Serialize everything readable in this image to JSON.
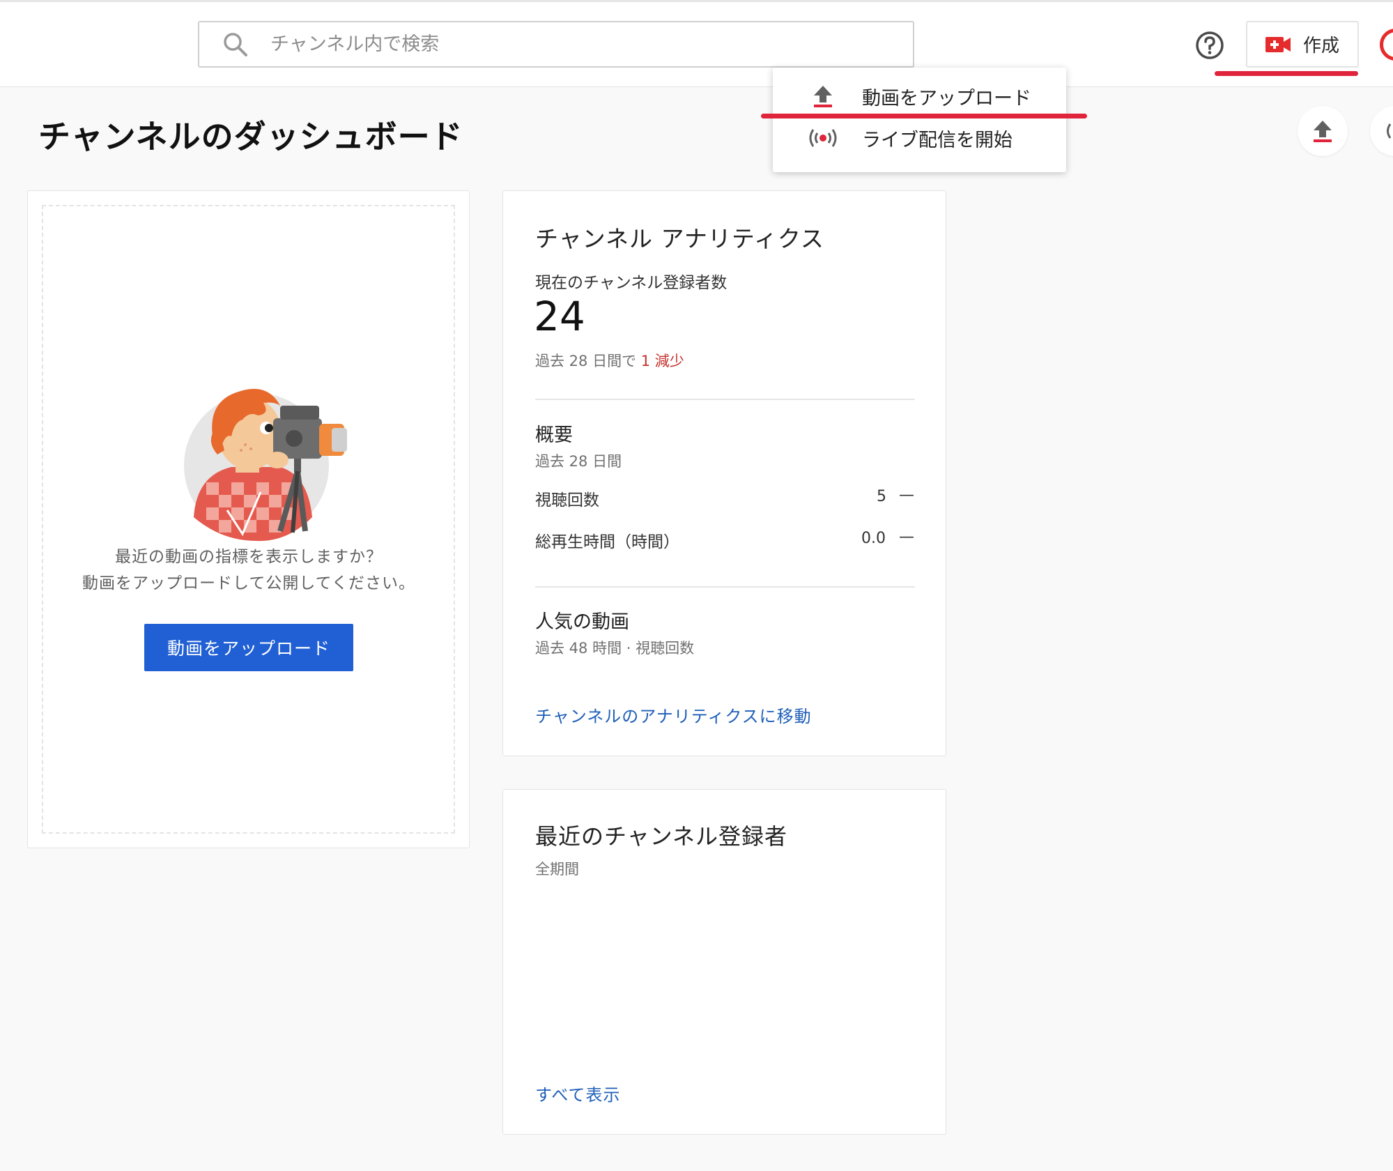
{
  "header": {
    "search_placeholder": "チャンネル内で検索",
    "create_label": "作成"
  },
  "create_menu": {
    "items": [
      {
        "label": "動画をアップロード",
        "icon": "upload-icon"
      },
      {
        "label": "ライブ配信を開始",
        "icon": "live-broadcast-icon"
      }
    ]
  },
  "page": {
    "title": "チャンネルのダッシュボード"
  },
  "upload_card": {
    "line1": "最近の動画の指標を表示しますか？",
    "line2": "動画をアップロードして公開してください。",
    "button_label": "動画をアップロード"
  },
  "analytics": {
    "title": "チャンネル アナリティクス",
    "subscribers_label": "現在のチャンネル登録者数",
    "subscribers_value": "24",
    "change_prefix": "過去 28 日間で",
    "change_value": "1 減少",
    "summary_title": "概要",
    "summary_period": "過去 28 日間",
    "metrics": [
      {
        "label": "視聴回数",
        "value": "5",
        "trend": "—"
      },
      {
        "label": "総再生時間（時間）",
        "value": "0.0",
        "trend": "—"
      }
    ],
    "top_videos_title": "人気の動画",
    "top_videos_period": "過去 48 時間 · 視聴回数",
    "link": "チャンネルのアナリティクスに移動"
  },
  "recent_subscribers": {
    "title": "最近のチャンネル登録者",
    "period": "全期間",
    "link": "すべて表示"
  },
  "colors": {
    "accent_blue": "#2160d4",
    "link_blue": "#1f5fb8",
    "decrease_red": "#c4302b",
    "annotation_red": "#e0243b",
    "create_icon_red": "#e52b2b"
  }
}
